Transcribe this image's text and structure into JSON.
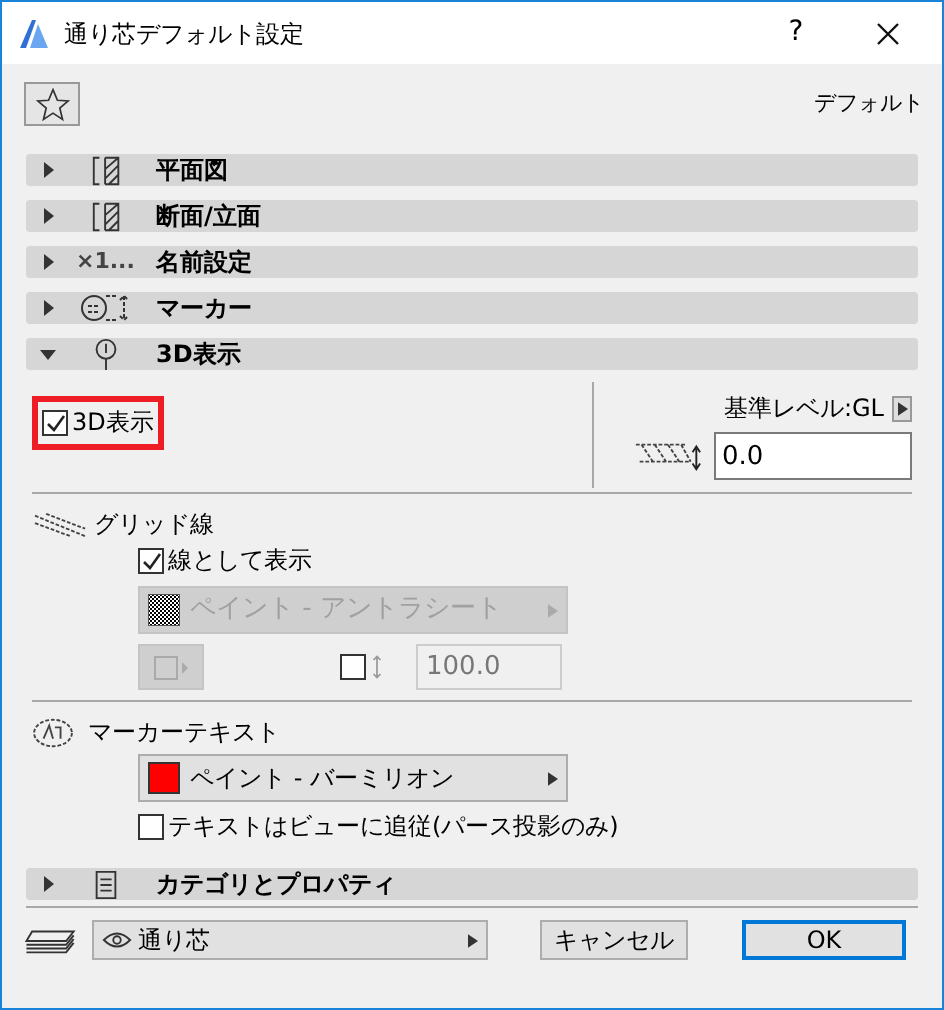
{
  "window": {
    "title": "通り芯デフォルト設定",
    "help": "?"
  },
  "favorites": {
    "label": "デフォルト"
  },
  "sections": [
    {
      "label": "平面図",
      "kind": "plan",
      "expanded": false
    },
    {
      "label": "断面/立面",
      "kind": "plan",
      "expanded": false
    },
    {
      "label": "名前設定",
      "kind": "name",
      "icon_text": "×1...",
      "expanded": false
    },
    {
      "label": "マーカー",
      "kind": "marker",
      "expanded": false
    },
    {
      "label": "3D表示",
      "kind": "pin",
      "expanded": true,
      "content": {
        "show_3d": {
          "label": "3D表示",
          "checked": true,
          "highlighted": true
        },
        "reference_level": {
          "label": "基準レベル:GL",
          "value": "0.0"
        },
        "grid_lines": {
          "label": "グリッド線",
          "show_as_line": {
            "label": "線として表示",
            "checked": true
          },
          "material": {
            "value": "ペイント - アントラシート",
            "disabled": true
          },
          "thickness": {
            "value": "100.0",
            "checked": false
          }
        },
        "marker_text": {
          "label": "マーカーテキスト",
          "material": {
            "value": "ペイント - バーミリオン",
            "color": "#ff0000"
          },
          "follow_view": {
            "label": "テキストはビューに追従(パース投影のみ)",
            "checked": false
          }
        }
      }
    },
    {
      "label": "カテゴリとプロパティ",
      "kind": "doc",
      "expanded": false
    }
  ],
  "footer": {
    "layer": "通り芯",
    "buttons": [
      {
        "label": "キャンセル",
        "default": false
      },
      {
        "label": "OK",
        "default": true
      }
    ]
  }
}
